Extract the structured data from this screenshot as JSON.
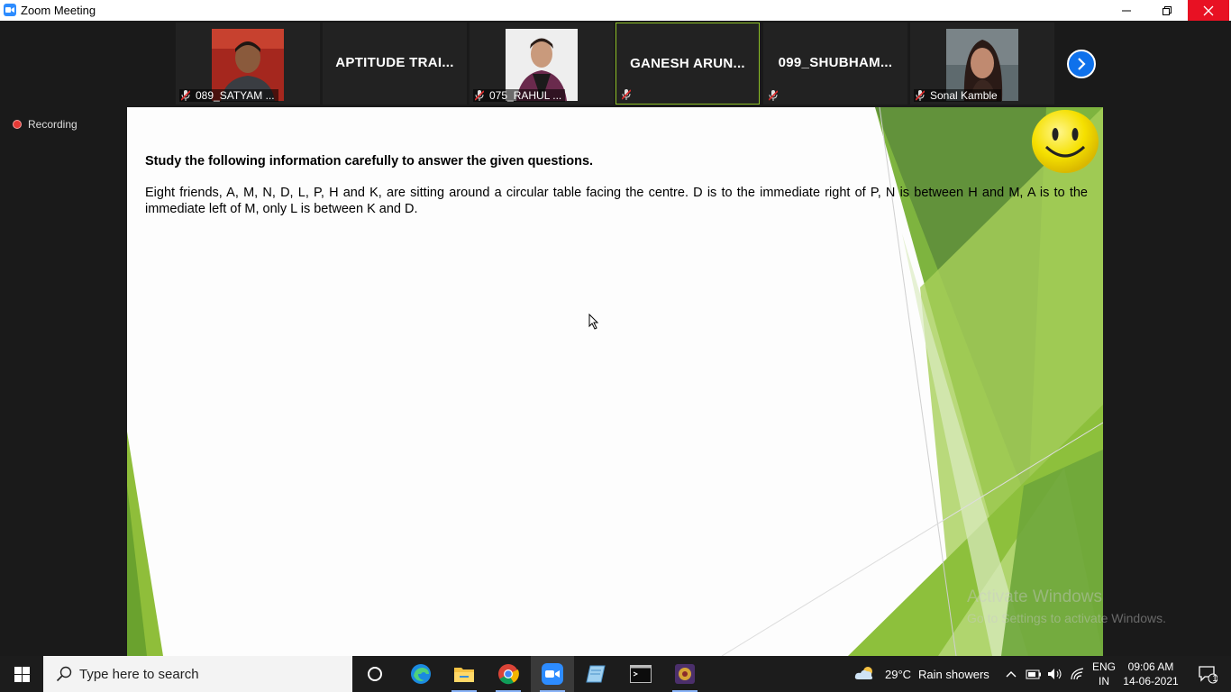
{
  "window": {
    "title": "Zoom Meeting"
  },
  "participants": [
    {
      "label": "089_SATYAM ...",
      "type": "photo",
      "muted": true,
      "active": false
    },
    {
      "label": "APTITUDE TRAI...",
      "type": "name",
      "muted": false,
      "active": false
    },
    {
      "label": "075_RAHUL ...",
      "type": "photo",
      "muted": true,
      "active": false
    },
    {
      "label": "GANESH ARUN...",
      "type": "name",
      "muted": true,
      "active": true
    },
    {
      "label": "099_SHUBHAM...",
      "type": "name",
      "muted": true,
      "active": false
    },
    {
      "label": "Sonal Kamble",
      "type": "photo",
      "muted": true,
      "active": false
    }
  ],
  "recording": {
    "label": "Recording"
  },
  "slide": {
    "heading": "Study the following information carefully to answer the given questions.",
    "paragraph": "Eight friends, A, M, N, D, L, P, H and K, are sitting around a circular table facing the centre. D is to the immediate right of P, N is between H and M, A is to the immediate left of M, only L is between K and D."
  },
  "watermark": {
    "line1": "Activate Windows",
    "line2": "Go to Settings to activate Windows."
  },
  "taskbar": {
    "search_placeholder": "Type here to search",
    "weather_temp": "29°C",
    "weather_text": "Rain showers",
    "lang_line1": "ENG",
    "lang_line2": "IN",
    "time": "09:06 AM",
    "date": "14-06-2021",
    "notification_count": "1"
  },
  "colors": {
    "zoom_blue": "#2d8cff",
    "active_border": "#8ec127",
    "close_red": "#e81123",
    "recording_red": "#e53935"
  }
}
